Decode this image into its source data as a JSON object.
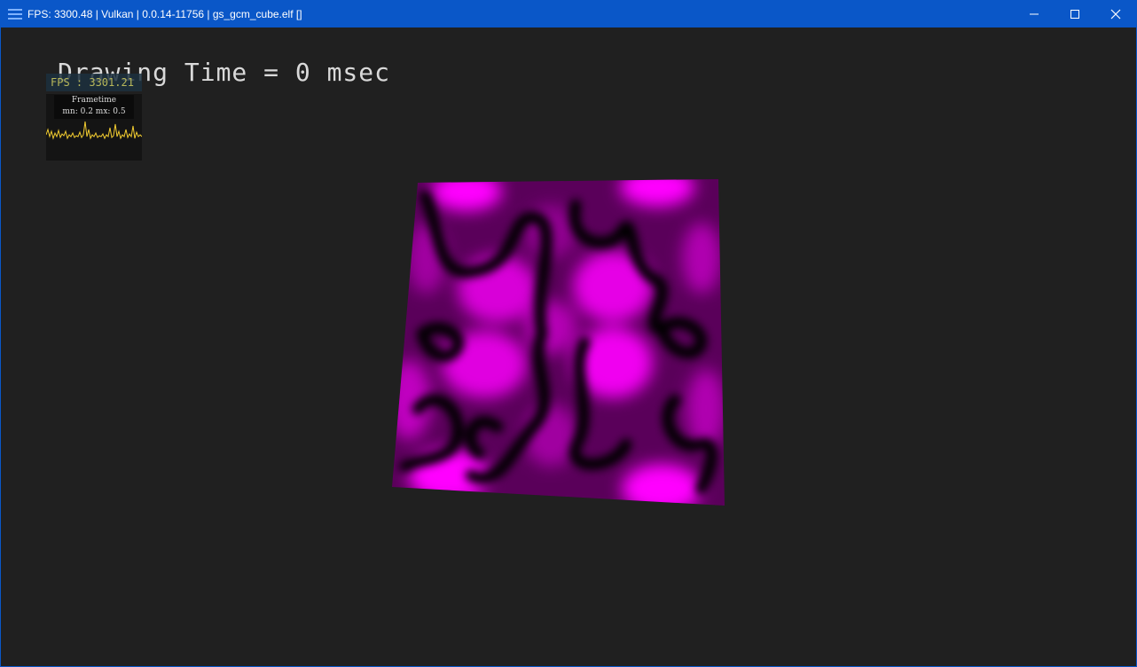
{
  "window": {
    "title": "FPS: 3300.48 | Vulkan | 0.0.14-11756 | gs_gcm_cube.elf []",
    "controls": {
      "minimize_icon": "minimize-icon",
      "maximize_icon": "maximize-icon",
      "close_icon": "close-icon"
    },
    "accent_color": "#0a57c8"
  },
  "overlay": {
    "drawing_time": "Drawing Time = 0 msec",
    "fps": "FPS : 3301.21",
    "frametime_title": "Frametime",
    "frametime_minmax": "mn: 0.2 mx: 0.5",
    "graph_color": "#f2cc30"
  },
  "scene": {
    "quad_color": "#ff00ff",
    "background": "#202020"
  }
}
